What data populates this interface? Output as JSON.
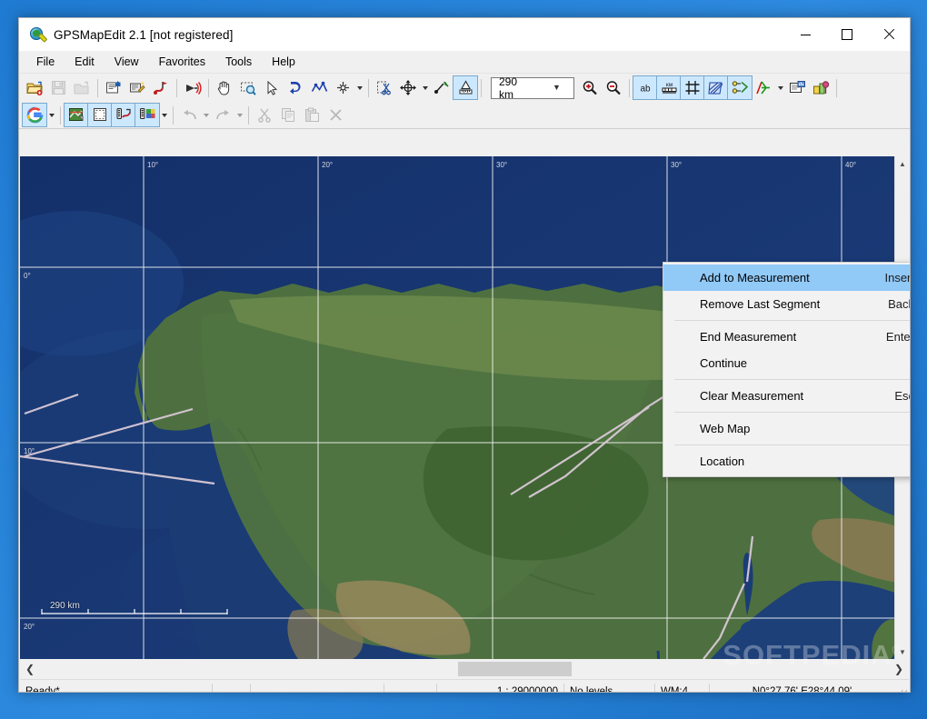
{
  "window": {
    "title": "GPSMapEdit 2.1 [not registered]",
    "app_icon": "globe-magnifier-icon",
    "controls": {
      "minimize": "minimize-button",
      "maximize": "maximize-button",
      "close": "close-button"
    }
  },
  "menubar": {
    "items": [
      {
        "label": "File"
      },
      {
        "label": "Edit"
      },
      {
        "label": "View"
      },
      {
        "label": "Favorites"
      },
      {
        "label": "Tools"
      },
      {
        "label": "Help"
      }
    ]
  },
  "toolbar_main": {
    "zoom_combo_value": "290 km",
    "buttons": [
      {
        "name": "open-map-icon",
        "state": "enabled"
      },
      {
        "name": "save-map-icon",
        "state": "disabled"
      },
      {
        "name": "close-map-icon",
        "state": "disabled"
      },
      {
        "name": "map-properties-icon",
        "state": "enabled"
      },
      {
        "name": "map-wizard-icon",
        "state": "enabled"
      },
      {
        "name": "route-tool-icon",
        "state": "enabled"
      },
      {
        "name": "gps-connect-icon",
        "state": "enabled"
      },
      {
        "name": "pan-hand-icon",
        "state": "enabled"
      },
      {
        "name": "zoom-rectangle-icon",
        "state": "enabled"
      },
      {
        "name": "select-arrow-icon",
        "state": "enabled"
      },
      {
        "name": "create-polygon-icon",
        "state": "enabled"
      },
      {
        "name": "create-polyline-icon",
        "state": "enabled"
      },
      {
        "name": "create-point-icon",
        "state": "enabled"
      },
      {
        "name": "cut-shape-icon",
        "state": "enabled"
      },
      {
        "name": "move-nodes-icon",
        "state": "enabled"
      },
      {
        "name": "add-node-icon",
        "state": "enabled"
      },
      {
        "name": "measure-tool-icon",
        "state": "active"
      },
      {
        "name": "zoom-in-icon",
        "state": "enabled"
      },
      {
        "name": "zoom-out-icon",
        "state": "enabled"
      },
      {
        "name": "show-labels-icon",
        "state": "active"
      },
      {
        "name": "show-scale-icon",
        "state": "active"
      },
      {
        "name": "show-grid-icon",
        "state": "active"
      },
      {
        "name": "show-hatching-icon",
        "state": "active"
      },
      {
        "name": "show-nodes-icon",
        "state": "active"
      },
      {
        "name": "levels-icon",
        "state": "enabled"
      },
      {
        "name": "map-report-icon",
        "state": "enabled"
      },
      {
        "name": "poi-manager-icon",
        "state": "enabled"
      }
    ]
  },
  "toolbar_secondary": {
    "buttons": [
      {
        "name": "google-web-map-icon",
        "state": "active"
      },
      {
        "name": "import-map-icon",
        "state": "active"
      },
      {
        "name": "new-layer-icon",
        "state": "active"
      },
      {
        "name": "measure-distance-icon",
        "state": "active"
      },
      {
        "name": "measure-area-icon",
        "state": "active"
      },
      {
        "name": "undo-icon",
        "state": "disabled"
      },
      {
        "name": "redo-icon",
        "state": "disabled"
      },
      {
        "name": "cut-icon",
        "state": "disabled"
      },
      {
        "name": "copy-icon",
        "state": "disabled"
      },
      {
        "name": "paste-icon",
        "state": "disabled"
      },
      {
        "name": "delete-icon",
        "state": "disabled"
      }
    ]
  },
  "context_menu": {
    "items": [
      {
        "label": "Add to Measurement",
        "accel": "Insert",
        "selected": true,
        "submenu": false,
        "separator_after": false
      },
      {
        "label": "Remove Last Segment",
        "accel": "Back",
        "selected": false,
        "submenu": false,
        "separator_after": true
      },
      {
        "label": "End Measurement",
        "accel": "Enter",
        "selected": false,
        "submenu": false,
        "separator_after": false
      },
      {
        "label": "Continue",
        "accel": "",
        "selected": false,
        "submenu": false,
        "separator_after": true
      },
      {
        "label": "Clear Measurement",
        "accel": "Esc",
        "selected": false,
        "submenu": false,
        "separator_after": true
      },
      {
        "label": "Web Map",
        "accel": "",
        "selected": false,
        "submenu": true,
        "separator_after": true
      },
      {
        "label": "Location",
        "accel": "",
        "selected": false,
        "submenu": true,
        "separator_after": false
      }
    ],
    "submenu_arrow": "chevron-right-icon"
  },
  "map": {
    "scale_bar_label": "290 km",
    "grid_labels_top": [
      "10°",
      "20°",
      "30°",
      "40°"
    ],
    "grid_labels_left": [
      "0°",
      "10°",
      "20°"
    ],
    "measurement_line_color": "#d9c9d6",
    "ocean_color": "#1b3f77",
    "land_color": "#4a6b3c",
    "grid_line_color": "#ffffff"
  },
  "scrollbars": {
    "h_left_arrow": "chevron-left-icon",
    "h_right_arrow": "chevron-right-icon",
    "v_up_arrow": "chevron-up-icon",
    "v_down_arrow": "chevron-down-icon"
  },
  "statusbar": {
    "ready": "Ready*",
    "cell2": "",
    "cell3": "",
    "cell4": "",
    "scale": "1 : 29000000",
    "levels": "No levels",
    "wm": "WM:4",
    "coords": "N0°27.76' E28°44.09'"
  },
  "watermark": {
    "text": "SOFTPEDIA",
    "mark": "®"
  }
}
